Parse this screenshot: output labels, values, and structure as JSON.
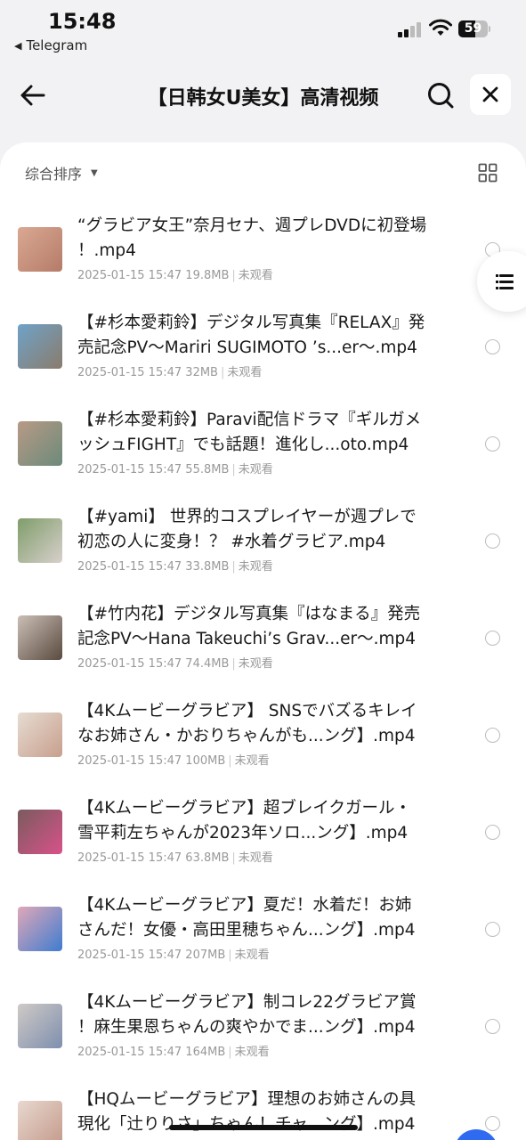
{
  "status_bar": {
    "time": "15:48",
    "back_app": "Telegram",
    "battery": "59",
    "battery_level": 0.59
  },
  "nav": {
    "title": "【日韩女U美女】高清视频",
    "back_icon": "arrow-left-icon",
    "search_icon": "search-icon",
    "close_icon": "close-icon"
  },
  "toolbar": {
    "sort_label": "综合排序",
    "grid_icon": "grid-icon"
  },
  "files": [
    {
      "title": "“グラビア女王”奈月セナ、週プレDVDに初登場\n！.mp4",
      "date": "2025-01-15 15:47",
      "size": "19.8MB",
      "status": "未观看",
      "thumb_colors": [
        "#d9a893",
        "#b57c68"
      ]
    },
    {
      "title": "【#杉本愛莉鈴】デジタル写真集『RELAX』発\n売記念PV～Mariri SUGIMOTO ’s...er～.mp4",
      "date": "2025-01-15 15:47",
      "size": "32MB",
      "status": "未观看",
      "thumb_colors": [
        "#6fa3c8",
        "#8a7b6c"
      ]
    },
    {
      "title": "【#杉本愛莉鈴】Paravi配信ドラマ『ギルガメ\nッシュFIGHT』でも話題！進化し...oto.mp4",
      "date": "2025-01-15 15:47",
      "size": "55.8MB",
      "status": "未观看",
      "thumb_colors": [
        "#b89a86",
        "#6c8a7a"
      ]
    },
    {
      "title": "【#yami】 世界的コスプレイヤーが週プレで\n初恋の人に変身！？ #水着グラビア.mp4",
      "date": "2025-01-15 15:47",
      "size": "33.8MB",
      "status": "未观看",
      "thumb_colors": [
        "#7f9d6a",
        "#d8d0cc"
      ]
    },
    {
      "title": "【#竹内花】デジタル写真集『はなまる』発売\n記念PV～Hana Takeuchi’s Grav...er～.mp4",
      "date": "2025-01-15 15:47",
      "size": "74.4MB",
      "status": "未观看",
      "thumb_colors": [
        "#cbbfb5",
        "#5a4a40"
      ]
    },
    {
      "title": "【4Kムービーグラビア】 SNSでバズるキレイ\nなお姉さん・かおりちゃんがも...ング】.mp4",
      "date": "2025-01-15 15:47",
      "size": "100MB",
      "status": "未观看",
      "thumb_colors": [
        "#e6dcd2",
        "#c89f8d"
      ]
    },
    {
      "title": "【4Kムービーグラビア】超ブレイクガール・\n雪平莉左ちゃんが2023年ソロ...ング】.mp4",
      "date": "2025-01-15 15:47",
      "size": "63.8MB",
      "status": "未观看",
      "thumb_colors": [
        "#7a5b5e",
        "#d8528a"
      ]
    },
    {
      "title": "【4Kムービーグラビア】夏だ！水着だ！お姉\nさんだ！女優・高田里穂ちゃん...ング】.mp4",
      "date": "2025-01-15 15:47",
      "size": "207MB",
      "status": "未观看",
      "thumb_colors": [
        "#e0a8b8",
        "#3f7cd0"
      ]
    },
    {
      "title": "【4Kムービーグラビア】制コレ22グラビア賞\n！麻生果恩ちゃんの爽やかでま...ング】.mp4",
      "date": "2025-01-15 15:47",
      "size": "164MB",
      "status": "未观看",
      "thumb_colors": [
        "#cfcac6",
        "#7e8fae"
      ]
    },
    {
      "title": "【HQムービーグラビア】理想のお姉さんの具\n現化「辻りりさ」ちゃん！チャ...ング】.mp4",
      "date": "",
      "size": "",
      "status": "",
      "thumb_colors": [
        "#e8d8d0",
        "#c49a8a"
      ]
    }
  ]
}
